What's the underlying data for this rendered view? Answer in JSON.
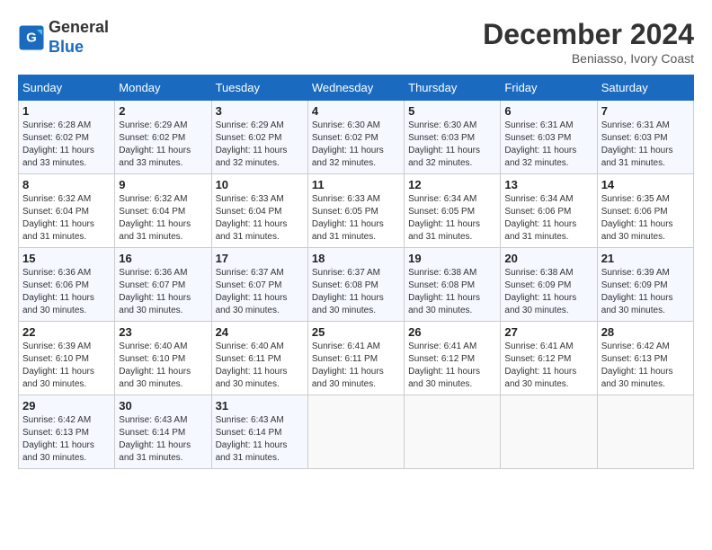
{
  "header": {
    "logo_line1": "General",
    "logo_line2": "Blue",
    "month_title": "December 2024",
    "location": "Beniasso, Ivory Coast"
  },
  "weekdays": [
    "Sunday",
    "Monday",
    "Tuesday",
    "Wednesday",
    "Thursday",
    "Friday",
    "Saturday"
  ],
  "weeks": [
    [
      {
        "day": "1",
        "sunrise": "6:28 AM",
        "sunset": "6:02 PM",
        "daylight": "11 hours and 33 minutes."
      },
      {
        "day": "2",
        "sunrise": "6:29 AM",
        "sunset": "6:02 PM",
        "daylight": "11 hours and 33 minutes."
      },
      {
        "day": "3",
        "sunrise": "6:29 AM",
        "sunset": "6:02 PM",
        "daylight": "11 hours and 32 minutes."
      },
      {
        "day": "4",
        "sunrise": "6:30 AM",
        "sunset": "6:02 PM",
        "daylight": "11 hours and 32 minutes."
      },
      {
        "day": "5",
        "sunrise": "6:30 AM",
        "sunset": "6:03 PM",
        "daylight": "11 hours and 32 minutes."
      },
      {
        "day": "6",
        "sunrise": "6:31 AM",
        "sunset": "6:03 PM",
        "daylight": "11 hours and 32 minutes."
      },
      {
        "day": "7",
        "sunrise": "6:31 AM",
        "sunset": "6:03 PM",
        "daylight": "11 hours and 31 minutes."
      }
    ],
    [
      {
        "day": "8",
        "sunrise": "6:32 AM",
        "sunset": "6:04 PM",
        "daylight": "11 hours and 31 minutes."
      },
      {
        "day": "9",
        "sunrise": "6:32 AM",
        "sunset": "6:04 PM",
        "daylight": "11 hours and 31 minutes."
      },
      {
        "day": "10",
        "sunrise": "6:33 AM",
        "sunset": "6:04 PM",
        "daylight": "11 hours and 31 minutes."
      },
      {
        "day": "11",
        "sunrise": "6:33 AM",
        "sunset": "6:05 PM",
        "daylight": "11 hours and 31 minutes."
      },
      {
        "day": "12",
        "sunrise": "6:34 AM",
        "sunset": "6:05 PM",
        "daylight": "11 hours and 31 minutes."
      },
      {
        "day": "13",
        "sunrise": "6:34 AM",
        "sunset": "6:06 PM",
        "daylight": "11 hours and 31 minutes."
      },
      {
        "day": "14",
        "sunrise": "6:35 AM",
        "sunset": "6:06 PM",
        "daylight": "11 hours and 30 minutes."
      }
    ],
    [
      {
        "day": "15",
        "sunrise": "6:36 AM",
        "sunset": "6:06 PM",
        "daylight": "11 hours and 30 minutes."
      },
      {
        "day": "16",
        "sunrise": "6:36 AM",
        "sunset": "6:07 PM",
        "daylight": "11 hours and 30 minutes."
      },
      {
        "day": "17",
        "sunrise": "6:37 AM",
        "sunset": "6:07 PM",
        "daylight": "11 hours and 30 minutes."
      },
      {
        "day": "18",
        "sunrise": "6:37 AM",
        "sunset": "6:08 PM",
        "daylight": "11 hours and 30 minutes."
      },
      {
        "day": "19",
        "sunrise": "6:38 AM",
        "sunset": "6:08 PM",
        "daylight": "11 hours and 30 minutes."
      },
      {
        "day": "20",
        "sunrise": "6:38 AM",
        "sunset": "6:09 PM",
        "daylight": "11 hours and 30 minutes."
      },
      {
        "day": "21",
        "sunrise": "6:39 AM",
        "sunset": "6:09 PM",
        "daylight": "11 hours and 30 minutes."
      }
    ],
    [
      {
        "day": "22",
        "sunrise": "6:39 AM",
        "sunset": "6:10 PM",
        "daylight": "11 hours and 30 minutes."
      },
      {
        "day": "23",
        "sunrise": "6:40 AM",
        "sunset": "6:10 PM",
        "daylight": "11 hours and 30 minutes."
      },
      {
        "day": "24",
        "sunrise": "6:40 AM",
        "sunset": "6:11 PM",
        "daylight": "11 hours and 30 minutes."
      },
      {
        "day": "25",
        "sunrise": "6:41 AM",
        "sunset": "6:11 PM",
        "daylight": "11 hours and 30 minutes."
      },
      {
        "day": "26",
        "sunrise": "6:41 AM",
        "sunset": "6:12 PM",
        "daylight": "11 hours and 30 minutes."
      },
      {
        "day": "27",
        "sunrise": "6:41 AM",
        "sunset": "6:12 PM",
        "daylight": "11 hours and 30 minutes."
      },
      {
        "day": "28",
        "sunrise": "6:42 AM",
        "sunset": "6:13 PM",
        "daylight": "11 hours and 30 minutes."
      }
    ],
    [
      {
        "day": "29",
        "sunrise": "6:42 AM",
        "sunset": "6:13 PM",
        "daylight": "11 hours and 30 minutes."
      },
      {
        "day": "30",
        "sunrise": "6:43 AM",
        "sunset": "6:14 PM",
        "daylight": "11 hours and 31 minutes."
      },
      {
        "day": "31",
        "sunrise": "6:43 AM",
        "sunset": "6:14 PM",
        "daylight": "11 hours and 31 minutes."
      },
      null,
      null,
      null,
      null
    ]
  ]
}
